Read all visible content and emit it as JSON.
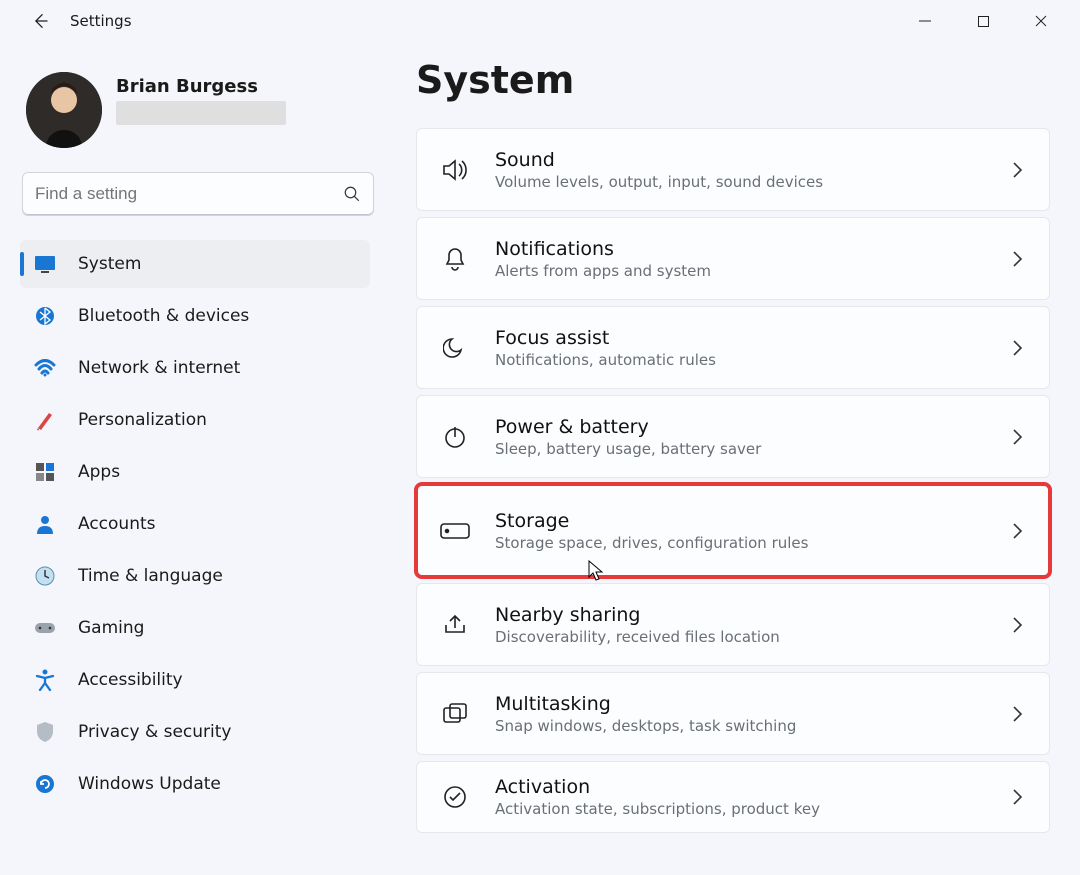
{
  "app_title": "Settings",
  "user": {
    "name": "Brian Burgess"
  },
  "search": {
    "placeholder": "Find a setting"
  },
  "sidebar": {
    "items": [
      {
        "id": "system",
        "label": "System",
        "selected": true
      },
      {
        "id": "bluetooth",
        "label": "Bluetooth & devices"
      },
      {
        "id": "network",
        "label": "Network & internet"
      },
      {
        "id": "personalization",
        "label": "Personalization"
      },
      {
        "id": "apps",
        "label": "Apps"
      },
      {
        "id": "accounts",
        "label": "Accounts"
      },
      {
        "id": "time",
        "label": "Time & language"
      },
      {
        "id": "gaming",
        "label": "Gaming"
      },
      {
        "id": "accessibility",
        "label": "Accessibility"
      },
      {
        "id": "privacy",
        "label": "Privacy & security"
      },
      {
        "id": "update",
        "label": "Windows Update"
      }
    ]
  },
  "main": {
    "title": "System",
    "cards": [
      {
        "id": "sound",
        "title": "Sound",
        "sub": "Volume levels, output, input, sound devices"
      },
      {
        "id": "notifications",
        "title": "Notifications",
        "sub": "Alerts from apps and system"
      },
      {
        "id": "focus",
        "title": "Focus assist",
        "sub": "Notifications, automatic rules"
      },
      {
        "id": "power",
        "title": "Power & battery",
        "sub": "Sleep, battery usage, battery saver"
      },
      {
        "id": "storage",
        "title": "Storage",
        "sub": "Storage space, drives, configuration rules",
        "highlighted": true
      },
      {
        "id": "nearby",
        "title": "Nearby sharing",
        "sub": "Discoverability, received files location"
      },
      {
        "id": "multitasking",
        "title": "Multitasking",
        "sub": "Snap windows, desktops, task switching"
      },
      {
        "id": "activation",
        "title": "Activation",
        "sub": "Activation state, subscriptions, product key"
      }
    ]
  }
}
